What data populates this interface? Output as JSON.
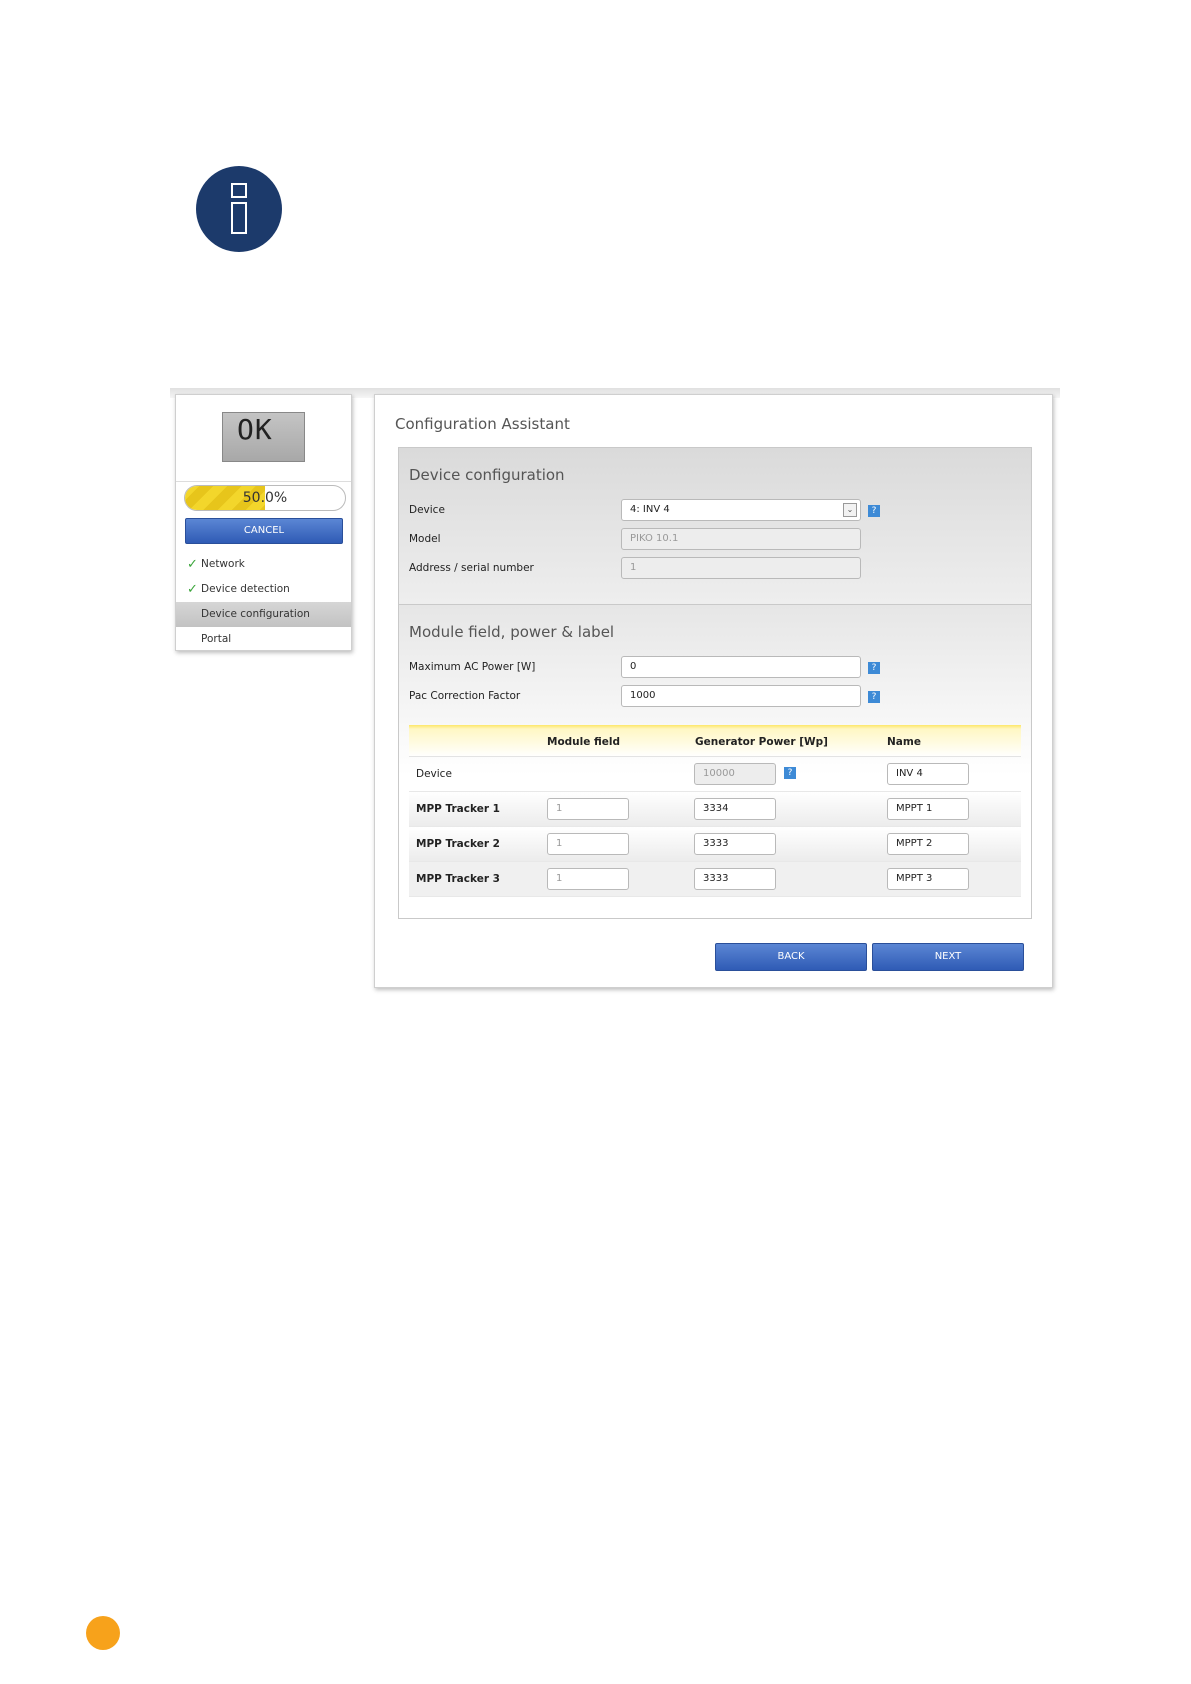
{
  "colors": {
    "info_icon": "#1c3a6b",
    "button": "#2f5bb5",
    "progress": "#f3d62b",
    "page_marker": "#f7a21b",
    "help": "#3d8ad6"
  },
  "icons": {
    "info": "info-icon",
    "check": "checkmark-icon",
    "help": "help-icon",
    "dropdown": "chevron-down-icon"
  },
  "sidebar": {
    "lcd_text": "OK",
    "progress": {
      "value": 0.5,
      "text": "50.0%"
    },
    "cancel_label": "CANCEL",
    "steps": [
      {
        "label": "Network",
        "done": true,
        "check": "✓"
      },
      {
        "label": "Device detection",
        "done": true,
        "check": "✓"
      },
      {
        "label": "Device configuration",
        "active": true
      },
      {
        "label": "Portal"
      }
    ]
  },
  "main": {
    "title": "Configuration Assistant",
    "device_config": {
      "title": "Device configuration",
      "device_label": "Device",
      "device_value": "4: INV 4",
      "model_label": "Model",
      "model_value": "PIKO 10.1",
      "address_label": "Address / serial number",
      "address_value": "1"
    },
    "module_field": {
      "title": "Module field, power & label",
      "max_ac_label": "Maximum AC Power [W]",
      "max_ac_value": "0",
      "pac_label": "Pac Correction Factor",
      "pac_value": "1000"
    },
    "help_symbol": "?",
    "table": {
      "headers": [
        "Module field",
        "Generator Power [Wp]",
        "Name"
      ],
      "rows": [
        {
          "label": "Device",
          "module_field": "",
          "generator_power": "10000",
          "name": "INV 4"
        },
        {
          "label": "MPP Tracker 1",
          "module_field": "1",
          "generator_power": "3334",
          "name": "MPPT 1"
        },
        {
          "label": "MPP Tracker 2",
          "module_field": "1",
          "generator_power": "3333",
          "name": "MPPT 2"
        },
        {
          "label": "MPP Tracker 3",
          "module_field": "1",
          "generator_power": "3333",
          "name": "MPPT 3"
        }
      ]
    },
    "back_label": "BACK",
    "next_label": "NEXT"
  }
}
